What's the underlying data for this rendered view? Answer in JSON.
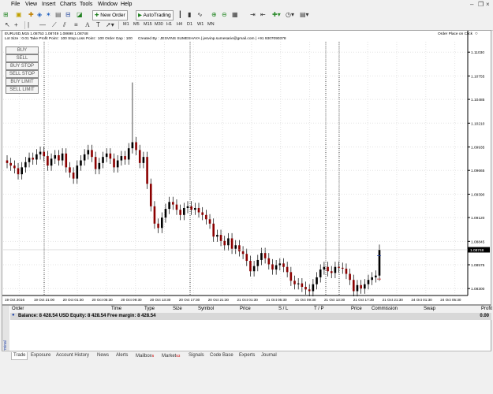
{
  "menu": [
    "File",
    "View",
    "Insert",
    "Charts",
    "Tools",
    "Window",
    "Help"
  ],
  "toolbar": {
    "new_order": "New Order",
    "autotrading": "AutoTrading"
  },
  "timeframes": [
    "M1",
    "M5",
    "M15",
    "M30",
    "H1",
    "H4",
    "D1",
    "W1",
    "MN"
  ],
  "chart": {
    "symbol_line": "EURUSD,M15  1.08753 1.08749 1.08698 1.08748",
    "ea_info": "Lot Size : 0.01 Take Profit Point : 100 Stop Loss Point : 100 Order Gap : 100",
    "author_info": "Created By : JESVINS SUMESHAYA | jesvinp.sumesarie@gmail.com | +91 9307090378",
    "order_place": "Order Place on Click",
    "trade_buttons": [
      "BUY",
      "SELL",
      "BUY STOP",
      "SELL STOP",
      "BUY LIMIT",
      "SELL LIMIT"
    ],
    "current_price": "1.08748"
  },
  "chart_data": {
    "type": "candlestick",
    "symbol": "EURUSD",
    "timeframe": "M15",
    "price_ticks": [
      "1.11030",
      "1.10755",
      "1.10485",
      "1.10210",
      "1.09935",
      "1.09665",
      "1.09390",
      "1.09120",
      "1.08845",
      "1.08575",
      "1.08300"
    ],
    "time_labels": [
      "19 Oct 2016",
      "19 Oct 21:00",
      "20 Oct 01:30",
      "20 Oct 05:30",
      "20 Oct 09:30",
      "20 Oct 13:30",
      "20 Oct 17:30",
      "20 Oct 21:30",
      "21 Oct 01:30",
      "21 Oct 05:30",
      "21 Oct 09:30",
      "21 Oct 13:30",
      "21 Oct 17:30",
      "21 Oct 21:30",
      "24 Oct 01:30",
      "24 Oct 05:30"
    ],
    "ylim": [
      1.0822,
      1.1115
    ],
    "close_path": [
      1.0975,
      1.0972,
      1.0969,
      1.0962,
      1.097,
      1.0976,
      1.0981,
      1.0979,
      1.0985,
      1.0988,
      1.0983,
      1.0972,
      1.098,
      1.0984,
      1.0978,
      1.0986,
      1.097,
      1.0964,
      1.0957,
      1.0972,
      1.0978,
      1.0985,
      1.099,
      1.0982,
      1.0968,
      1.0975,
      1.0982,
      1.0986,
      1.098,
      1.097,
      1.0978,
      1.0983,
      1.0979,
      1.0992,
      1.0999,
      1.099,
      1.0975,
      1.0982,
      1.0951,
      1.0925,
      1.0905,
      1.09,
      1.0912,
      1.0922,
      1.093,
      1.0927,
      1.0921,
      1.0915,
      1.0923,
      1.0925,
      1.0921,
      1.0923,
      1.0918,
      1.0915,
      1.091,
      1.0905,
      1.089,
      1.0892,
      1.0885,
      1.088,
      1.0888,
      1.0876,
      1.088,
      1.0873,
      1.087,
      1.0862,
      1.085,
      1.0856,
      1.0863,
      1.0871,
      1.0865,
      1.0858,
      1.0852,
      1.0857,
      1.0859,
      1.0855,
      1.0849,
      1.0839,
      1.0835,
      1.0836,
      1.0832,
      1.0829,
      1.0827,
      1.0835,
      1.0843,
      1.0852,
      1.0855,
      1.085,
      1.0848,
      1.0855,
      1.0854,
      1.0853,
      1.0847,
      1.084,
      1.0827,
      1.0834,
      1.083,
      1.0835,
      1.084,
      1.0843,
      1.0845,
      1.08748
    ]
  },
  "terminal": {
    "columns": [
      "Order",
      "Time",
      "Type",
      "Size",
      "Symbol",
      "Price",
      "S / L",
      "T / P",
      "Price",
      "Commission",
      "Swap",
      "Profit"
    ],
    "balance_text": "Balance: 8 428.54 USD  Equity: 8 428.54  Free margin: 8 428.54",
    "balance_profit": "0.00",
    "title": "Terminal",
    "tabs": [
      "Trade",
      "Exposure",
      "Account History",
      "News",
      "Alerts",
      "Mailbox",
      "Market",
      "Signals",
      "Code Base",
      "Experts",
      "Journal"
    ],
    "mailbox_badge": "6",
    "market_badge": "63"
  },
  "colors": {
    "bull": "#000000",
    "bear": "#8b0000",
    "grid": "#d8d8d8",
    "accent_buttons": "#f4f4f4"
  }
}
